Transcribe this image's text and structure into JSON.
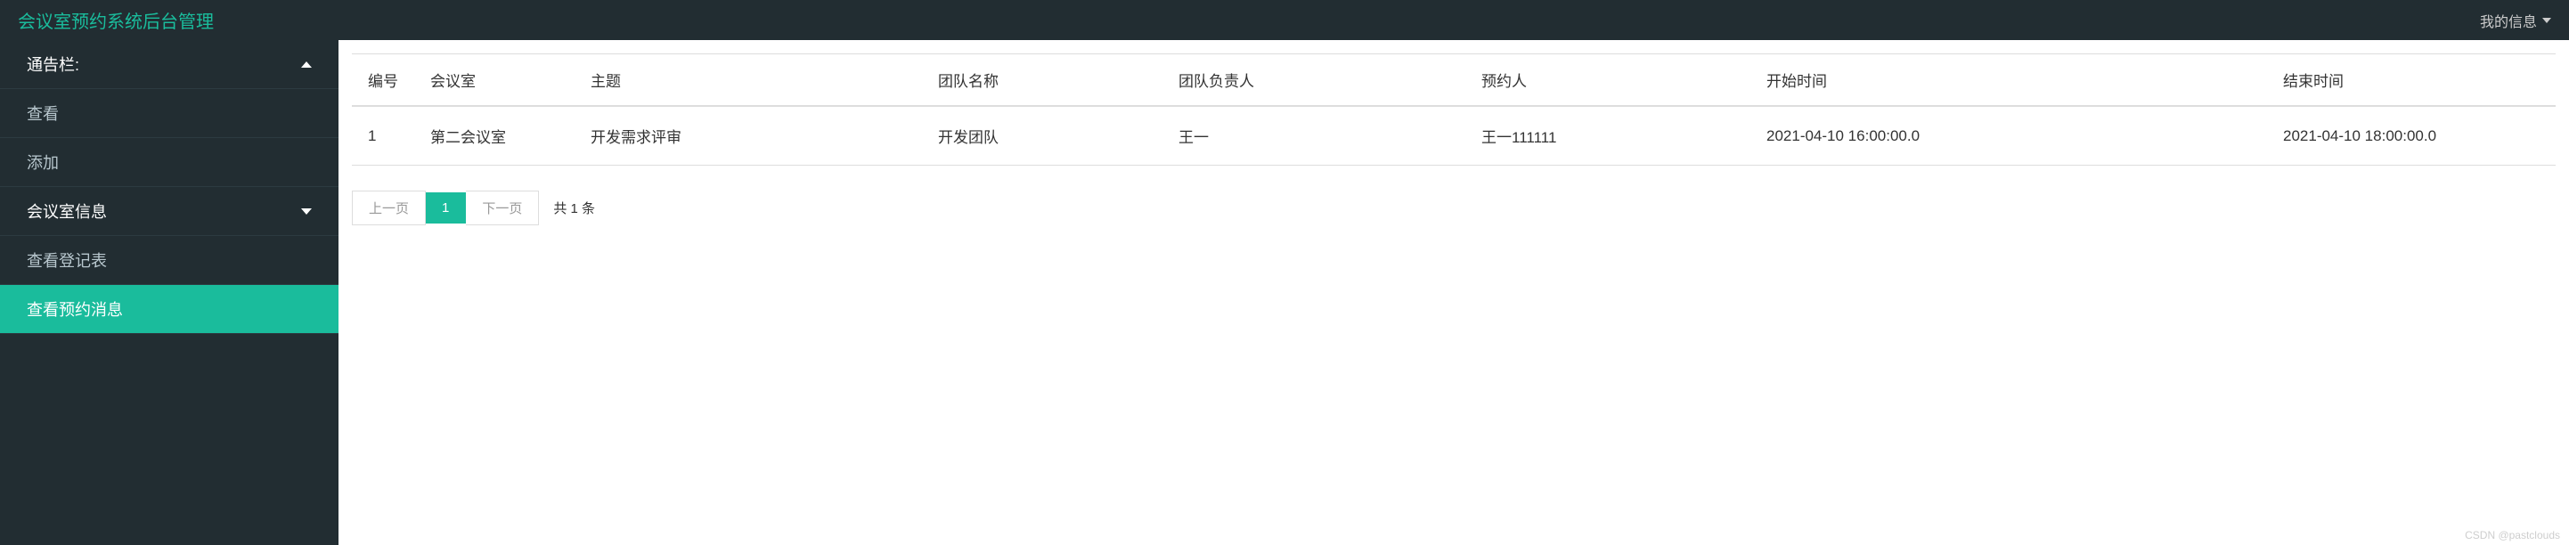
{
  "header": {
    "brand": "会议室预约系统后台管理",
    "user_menu": "我的信息"
  },
  "sidebar": {
    "groups": [
      {
        "label": "通告栏:",
        "expanded": true,
        "items": [
          {
            "label": "查看",
            "active": false
          },
          {
            "label": "添加",
            "active": false
          }
        ]
      },
      {
        "label": "会议室信息",
        "expanded": false,
        "items": []
      }
    ],
    "extra_items": [
      {
        "label": "查看登记表",
        "active": false
      },
      {
        "label": "查看预约消息",
        "active": true
      }
    ]
  },
  "table": {
    "headers": {
      "id": "编号",
      "room": "会议室",
      "topic": "主题",
      "team": "团队名称",
      "leader": "团队负责人",
      "booker": "预约人",
      "start": "开始时间",
      "end": "结束时间"
    },
    "rows": [
      {
        "id": "1",
        "room": "第二会议室",
        "topic": "开发需求评审",
        "team": "开发团队",
        "leader": "王一",
        "booker": "王一111111",
        "start": "2021-04-10 16:00:00.0",
        "end": "2021-04-10 18:00:00.0"
      }
    ]
  },
  "pagination": {
    "prev": "上一页",
    "current": "1",
    "next": "下一页",
    "total": "共 1 条"
  },
  "watermark": "CSDN @pastclouds"
}
